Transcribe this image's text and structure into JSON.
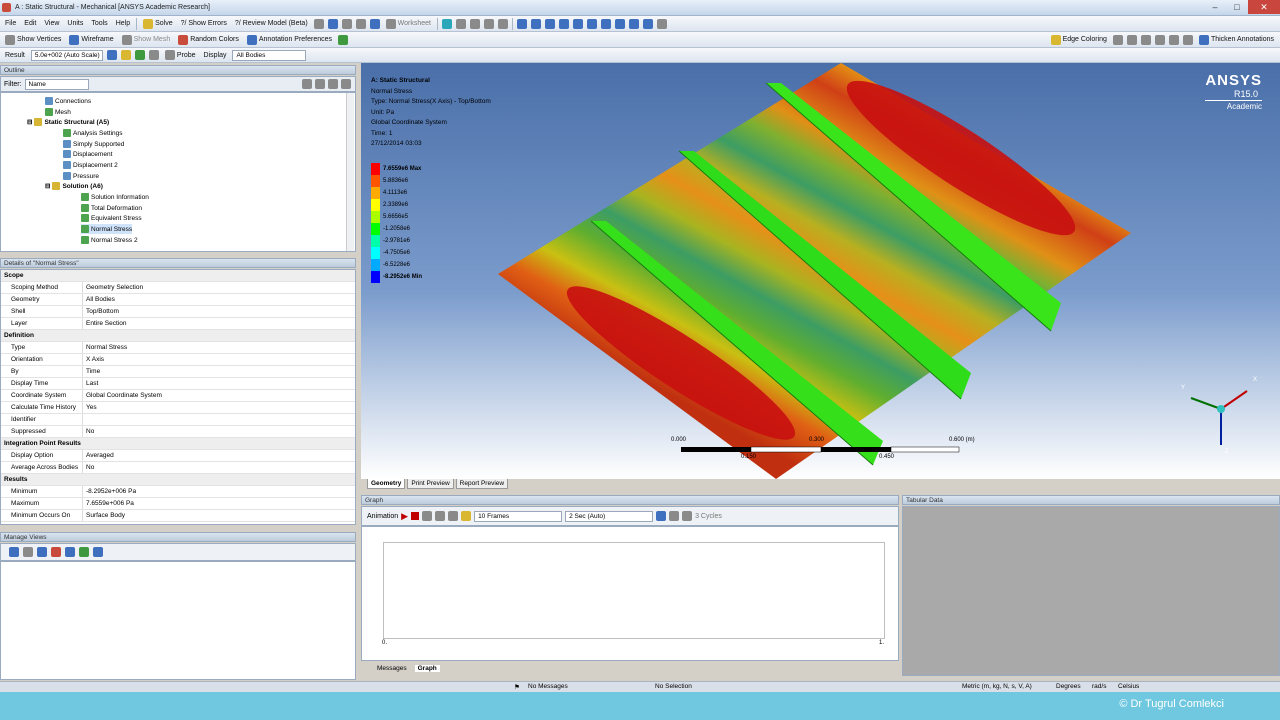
{
  "title": "A : Static Structural - Mechanical [ANSYS Academic Research]",
  "menu": [
    "File",
    "Edit",
    "View",
    "Units",
    "Tools",
    "Help"
  ],
  "toolbar1": {
    "solve": "Solve",
    "show_errors": "?/ Show Errors",
    "review_model": "?/ Review Model (Beta)",
    "worksheet": "Worksheet"
  },
  "toolbar2": {
    "show_vertices": "Show Vertices",
    "wireframe": "Wireframe",
    "show_mesh": "Show Mesh",
    "random_colors": "Random Colors",
    "annotation_preferences": "Annotation Preferences",
    "edge_coloring": "Edge Coloring",
    "thicken_annotations": "Thicken Annotations"
  },
  "toolbar3": {
    "result_label": "Result",
    "scale": "5.0e+002 (Auto Scale)",
    "probe": "Probe",
    "display_label": "Display",
    "display_value": "All Bodies"
  },
  "outline": {
    "title": "Outline",
    "filter_label": "Filter:",
    "filter_value": "Name",
    "items": [
      "Connections",
      "Mesh",
      "Static Structural (A5)",
      "Analysis Settings",
      "Simply Supported",
      "Displacement",
      "Displacement 2",
      "Pressure",
      "Solution (A6)",
      "Solution Information",
      "Total Deformation",
      "Equivalent Stress",
      "Normal Stress",
      "Normal Stress 2"
    ]
  },
  "details": {
    "title": "Details of \"Normal Stress\"",
    "rows": [
      {
        "k": "Scope",
        "v": "",
        "sec": true
      },
      {
        "k": "Scoping Method",
        "v": "Geometry Selection"
      },
      {
        "k": "Geometry",
        "v": "All Bodies"
      },
      {
        "k": "Shell",
        "v": "Top/Bottom"
      },
      {
        "k": "Layer",
        "v": "Entire Section"
      },
      {
        "k": "Definition",
        "v": "",
        "sec": true
      },
      {
        "k": "Type",
        "v": "Normal Stress"
      },
      {
        "k": "Orientation",
        "v": "X Axis"
      },
      {
        "k": "By",
        "v": "Time"
      },
      {
        "k": "Display Time",
        "v": "Last"
      },
      {
        "k": "Coordinate System",
        "v": "Global Coordinate System"
      },
      {
        "k": "Calculate Time History",
        "v": "Yes"
      },
      {
        "k": "Identifier",
        "v": ""
      },
      {
        "k": "Suppressed",
        "v": "No"
      },
      {
        "k": "Integration Point Results",
        "v": "",
        "sec": true
      },
      {
        "k": "Display Option",
        "v": "Averaged"
      },
      {
        "k": "Average Across Bodies",
        "v": "No"
      },
      {
        "k": "Results",
        "v": "",
        "sec": true
      },
      {
        "k": "Minimum",
        "v": "-8.2952e+006 Pa"
      },
      {
        "k": "Maximum",
        "v": "7.6559e+006 Pa"
      },
      {
        "k": "Minimum Occurs On",
        "v": "Surface Body"
      }
    ]
  },
  "manage_views": {
    "title": "Manage Views"
  },
  "viewport": {
    "header": [
      "A: Static Structural",
      "Normal Stress",
      "Type: Normal Stress(X Axis) - Top/Bottom",
      "Unit: Pa",
      "Global Coordinate System",
      "Time: 1",
      "27/12/2014 03:03"
    ],
    "legend": [
      {
        "label": "7.6559e6 Max",
        "color": "#ff0000"
      },
      {
        "label": "5.8836e6",
        "color": "#ff5500"
      },
      {
        "label": "4.1113e6",
        "color": "#ffaa00"
      },
      {
        "label": "2.3389e6",
        "color": "#ffff00"
      },
      {
        "label": "5.6656e5",
        "color": "#aaff00"
      },
      {
        "label": "-1.2058e6",
        "color": "#00ff00"
      },
      {
        "label": "-2.9781e6",
        "color": "#00ffaa"
      },
      {
        "label": "-4.7505e6",
        "color": "#00ffff"
      },
      {
        "label": "-6.5228e6",
        "color": "#00aaff"
      },
      {
        "label": "-8.2952e6 Min",
        "color": "#0000ff"
      }
    ],
    "brand": "ANSYS",
    "version": "R15.0",
    "edition": "Academic",
    "scale_left": "0.000",
    "scale_mid": "0.300",
    "scale_right": "0.600 (m)",
    "scale_q1": "0.150",
    "scale_q3": "0.450",
    "axis_x": "X",
    "axis_y": "Y",
    "axis_z": "Z",
    "tabs": [
      "Geometry",
      "Print Preview",
      "Report Preview"
    ]
  },
  "graph": {
    "title": "Graph",
    "animation": "Animation",
    "frames": "10 Frames",
    "duration": "2 Sec (Auto)",
    "cycles": "3 Cycles",
    "x_start": "0.",
    "x_end": "1.",
    "tabs": [
      "Messages",
      "Graph"
    ]
  },
  "tabular": {
    "title": "Tabular Data"
  },
  "status": {
    "messages": "No Messages",
    "selection": "No Selection",
    "units": "Metric (m, kg, N, s, V, A)",
    "degrees": "Degrees",
    "rad": "rad/s",
    "celsius": "Celsius"
  },
  "watermark": "© Dr Tugrul Comlekci"
}
